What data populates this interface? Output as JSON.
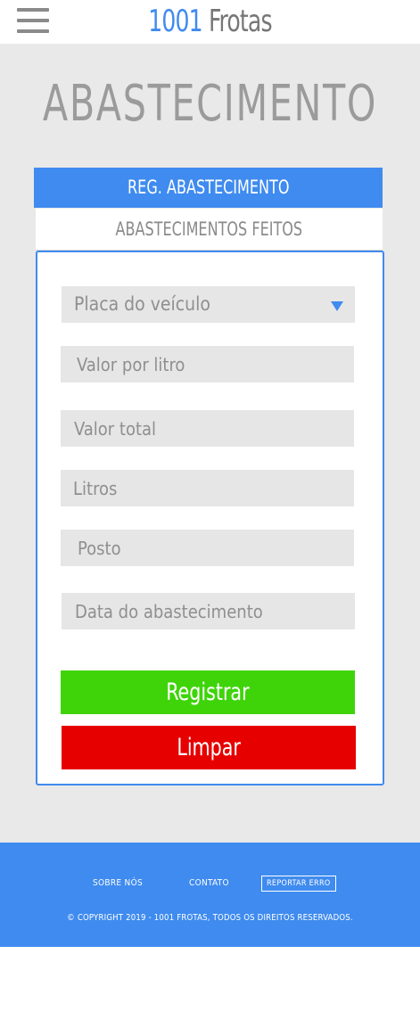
{
  "header": {
    "logo_number": "1001",
    "logo_word": "Frotas"
  },
  "page": {
    "title": "ABASTECIMENTO"
  },
  "tabs": {
    "register": "REG. ABASTECIMENTO",
    "history": "ABASTECIMENTOS FEITOS"
  },
  "form": {
    "vehicle_plate": "Placa do veículo",
    "price_per_liter": "Valor por litro",
    "total_value": "Valor total",
    "liters": "Litros",
    "gas_station": "Posto",
    "refuel_date": "Data do abastecimento"
  },
  "buttons": {
    "register": "Registrar",
    "clear": "Limpar"
  },
  "footer": {
    "about": "SOBRE NÓS",
    "contact": "CONTATO",
    "report_error": "REPORTAR ERRO",
    "copyright": "© COPYRIGHT 2019 - 1001 FROTAS, TODOS OS DIREITOS RESERVADOS."
  },
  "colors": {
    "primary_blue": "#3f8bef",
    "register_green": "#3fd40a",
    "clear_red": "#e60000",
    "background_gray": "#e9e9e9"
  },
  "icons": {
    "menu": "hamburger-menu-icon",
    "select": "dropdown-arrow-icon"
  }
}
